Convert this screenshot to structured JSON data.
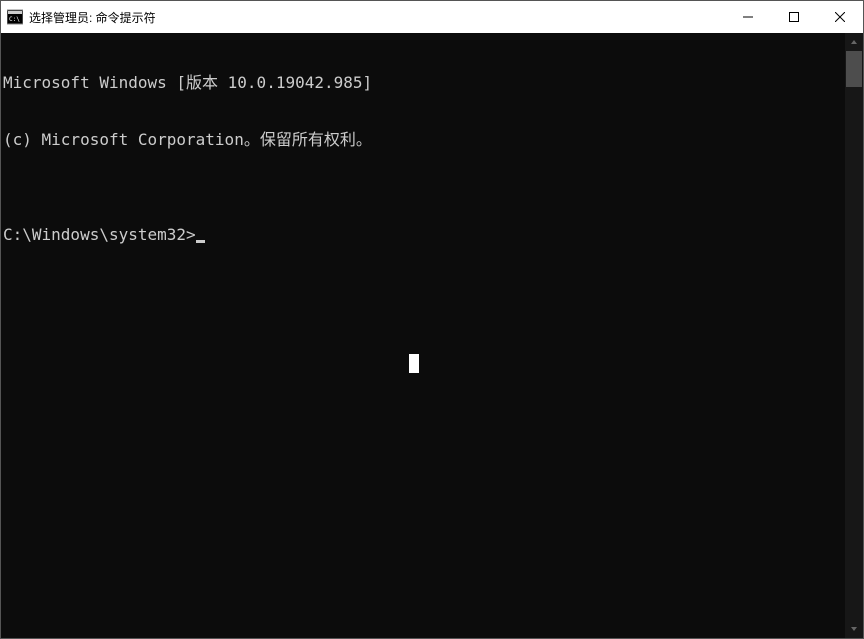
{
  "window": {
    "title": "选择管理员: 命令提示符"
  },
  "terminal": {
    "line1": "Microsoft Windows [版本 10.0.19042.985]",
    "line2": "(c) Microsoft Corporation。保留所有权利。",
    "blank": "",
    "prompt": "C:\\Windows\\system32>"
  }
}
